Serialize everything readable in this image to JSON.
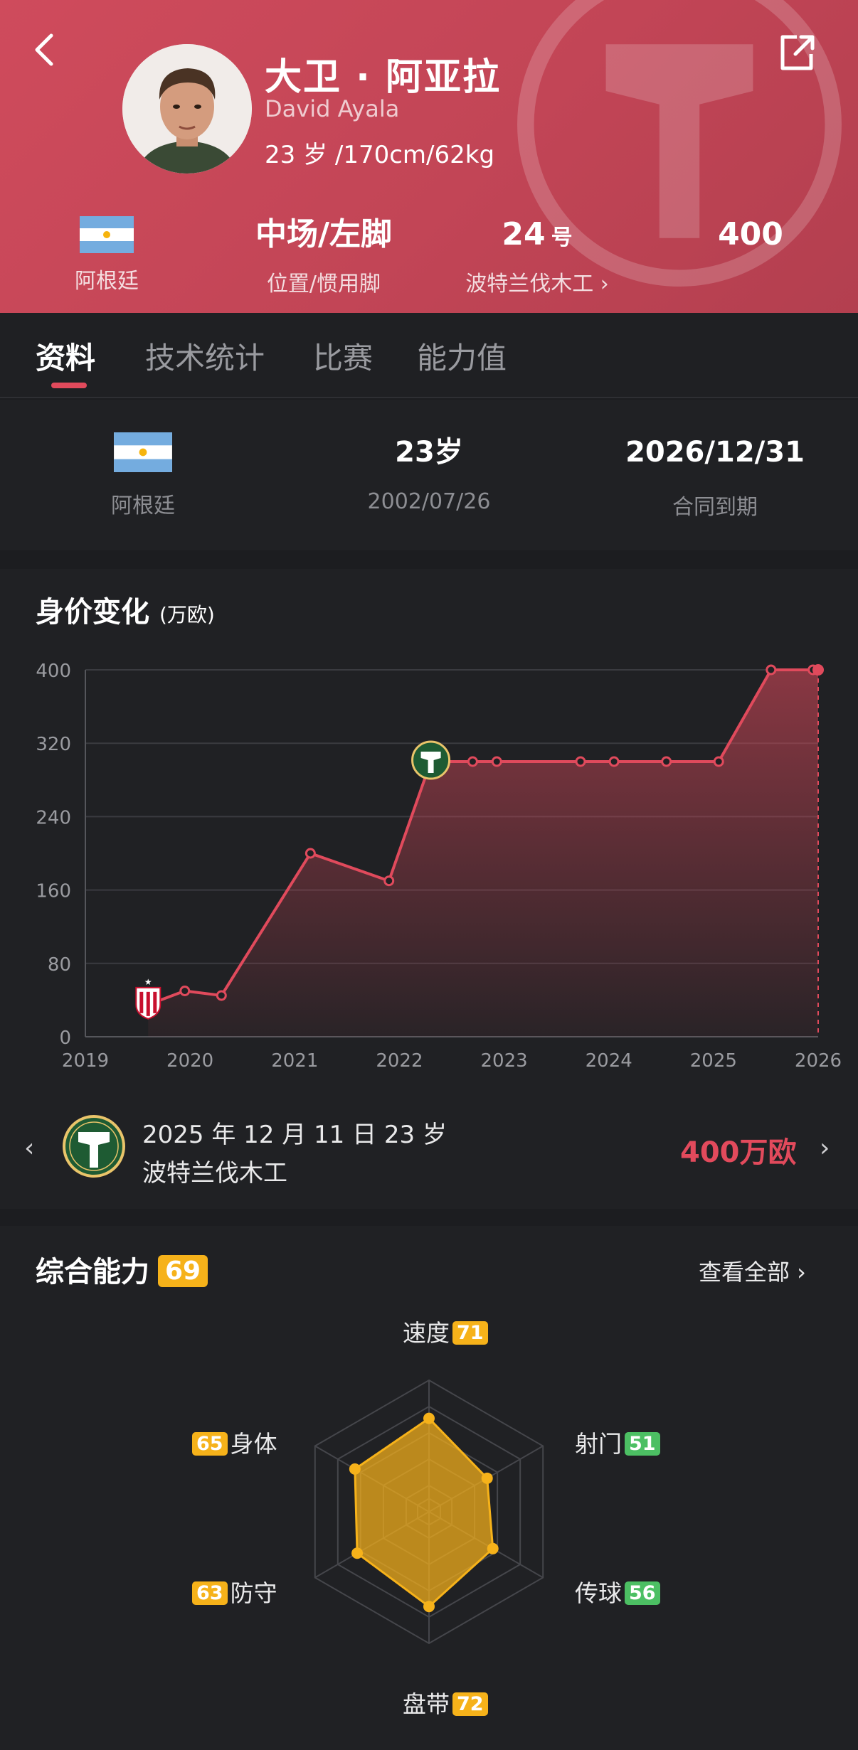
{
  "player": {
    "name_cn": "大卫 · 阿亚拉",
    "name_en": "David Ayala",
    "info": "23 岁 /170cm/62kg"
  },
  "stats": {
    "nationality": {
      "label": "阿根廷"
    },
    "position": {
      "value": "中场/左脚",
      "label": "位置/惯用脚"
    },
    "number": {
      "value": "24",
      "unit": "号",
      "label": "波特兰伐木工 ›"
    },
    "market": {
      "value": "400"
    }
  },
  "tabs": [
    "资料",
    "技术统计",
    "比赛",
    "能力值"
  ],
  "info": {
    "country": "阿根廷",
    "age": "23岁",
    "birthday": "2002/07/26",
    "contract": "2026/12/31",
    "contract_label": "合同到期"
  },
  "value_section": {
    "title": "身价变化",
    "unit": "(万欧)"
  },
  "chart_data": {
    "type": "line",
    "x_labels": [
      "2019",
      "2020",
      "2021",
      "2022",
      "2023",
      "2024",
      "2025",
      "2026"
    ],
    "y_ticks": [
      "0",
      "80",
      "160",
      "240",
      "320",
      "400"
    ],
    "ylim": [
      0,
      400
    ],
    "xlim": [
      2019,
      2026
    ],
    "grid": true,
    "points": [
      {
        "x": 2019.6,
        "y": 35
      },
      {
        "x": 2019.95,
        "y": 50
      },
      {
        "x": 2020.3,
        "y": 45
      },
      {
        "x": 2021.15,
        "y": 200
      },
      {
        "x": 2021.9,
        "y": 170
      },
      {
        "x": 2022.3,
        "y": 300
      },
      {
        "x": 2022.7,
        "y": 300
      },
      {
        "x": 2022.93,
        "y": 300
      },
      {
        "x": 2023.73,
        "y": 300
      },
      {
        "x": 2024.05,
        "y": 300
      },
      {
        "x": 2024.55,
        "y": 300
      },
      {
        "x": 2025.05,
        "y": 300
      },
      {
        "x": 2025.55,
        "y": 400
      },
      {
        "x": 2025.95,
        "y": 400
      }
    ],
    "color": "#e04a5c"
  },
  "history": {
    "line1": "2025 年 12 月 11 日  23 岁",
    "line2": "波特兰伐木工",
    "value": "400万欧"
  },
  "ability": {
    "title": "综合能力",
    "overall": "69",
    "more": "查看全部 ›",
    "attributes": [
      {
        "name": "速度",
        "value": 71,
        "color": "#f6b21a"
      },
      {
        "name": "射门",
        "value": 51,
        "color": "#4cbf63"
      },
      {
        "name": "传球",
        "value": 56,
        "color": "#4cbf63"
      },
      {
        "name": "盘带",
        "value": 72,
        "color": "#f6b21a"
      },
      {
        "name": "防守",
        "value": 63,
        "color": "#f6b21a"
      },
      {
        "name": "身体",
        "value": 65,
        "color": "#f6b21a"
      }
    ]
  }
}
